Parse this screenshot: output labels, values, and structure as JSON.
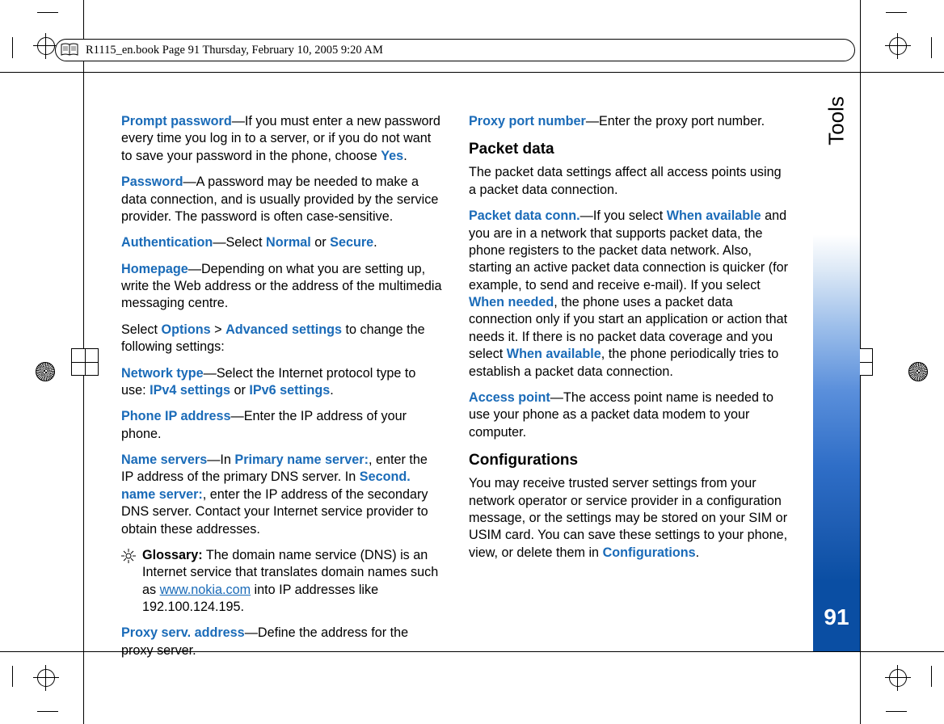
{
  "header": {
    "text": "R1115_en.book  Page 91  Thursday, February 10, 2005  9:20 AM"
  },
  "side": {
    "title": "Tools",
    "page": "91"
  },
  "col1": {
    "p1a": "Prompt password",
    "p1b": "—If you must enter a new password every time you log in to a server, or if you do not want to save your password in the phone, choose ",
    "p1c": "Yes",
    "p1d": ".",
    "p2a": "Password",
    "p2b": "—A password may be needed to make a data connection, and is usually provided by the service provider. The password is often case-sensitive.",
    "p3a": "Authentication",
    "p3b": "—Select ",
    "p3c": "Normal",
    "p3d": " or ",
    "p3e": "Secure",
    "p3f": ".",
    "p4a": "Homepage",
    "p4b": "—Depending on what you are setting up, write the Web address or the address of the multimedia messaging centre.",
    "p5a": "Select ",
    "p5b": "Options",
    "p5c": " > ",
    "p5d": "Advanced settings",
    "p5e": " to change the following settings:",
    "p6a": "Network type",
    "p6b": "—Select the Internet protocol type to use: ",
    "p6c": "IPv4 settings",
    "p6d": " or ",
    "p6e": "IPv6 settings",
    "p6f": ".",
    "p7a": "Phone IP address",
    "p7b": "—Enter the IP address of your phone.",
    "p8a": "Name servers",
    "p8b": "—In ",
    "p8c": "Primary name server:",
    "p8d": ", enter the IP address of the primary DNS server. In ",
    "p8e": "Second. name server:",
    "p8f": ", enter the IP address of the secondary DNS server. Contact your Internet service provider to obtain these addresses.",
    "g1a": "Glossary:",
    "g1b": " The domain name service (DNS) is an Internet service that translates domain names such as ",
    "g1c": "www.nokia.com",
    "g1d": " into IP addresses like 192.100.124.195.",
    "p9a": "Proxy serv. address",
    "p9b": "—Define the address for the proxy server."
  },
  "col2": {
    "p1a": "Proxy port number",
    "p1b": "—Enter the proxy port number.",
    "h1": "Packet data",
    "p2": "The packet data settings affect all access points using a packet data connection.",
    "p3a": "Packet data conn.",
    "p3b": "—If you select ",
    "p3c": "When available",
    "p3d": " and you are in a network that supports packet data, the phone registers to the packet data network. Also, starting an active packet data connection is quicker (for example, to send and receive e-mail). If you select ",
    "p3e": "When needed",
    "p3f": ", the phone uses a packet data connection only if you start an application or action that needs it. If there is no packet data coverage and you select ",
    "p3g": "When available",
    "p3h": ", the phone periodically tries to establish a packet data connection.",
    "p4a": "Access point",
    "p4b": "—The access point name is needed to use your phone as a packet data modem to your computer.",
    "h2": "Configurations",
    "p5a": "You may receive trusted server settings from your network operator or service provider in a configuration message, or the settings may be stored on your SIM or USIM card. You can save these settings to your phone, view, or delete them in ",
    "p5b": "Configurations",
    "p5c": "."
  }
}
